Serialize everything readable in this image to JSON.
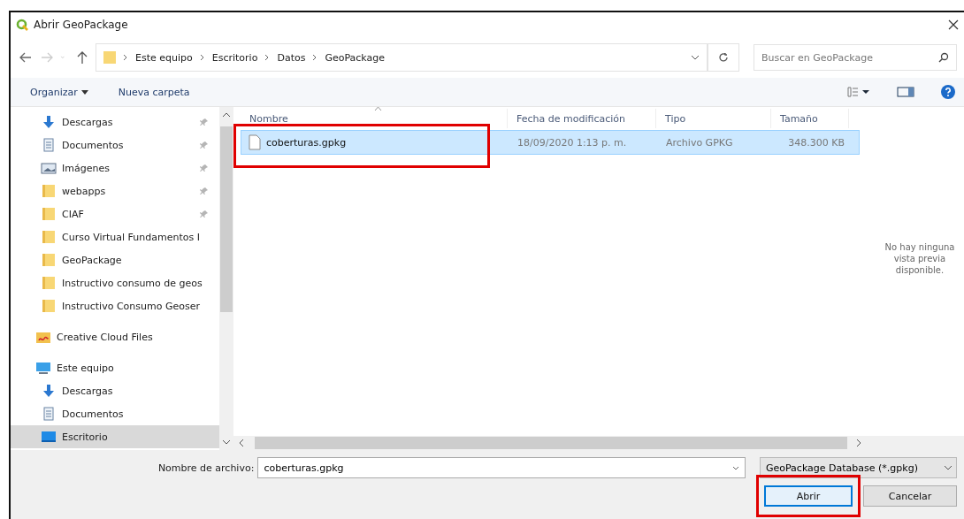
{
  "window": {
    "title": "Abrir GeoPackage"
  },
  "address_bar": {
    "path": [
      "Este equipo",
      "Escritorio",
      "Datos",
      "GeoPackage"
    ]
  },
  "search": {
    "placeholder": "Buscar en GeoPackage"
  },
  "toolbar": {
    "organize": "Organizar",
    "new_folder": "Nueva carpeta"
  },
  "sidebar": {
    "quick_access": [
      {
        "label": "Descargas",
        "kind": "download",
        "pinned": true,
        "selected": false
      },
      {
        "label": "Documentos",
        "kind": "document",
        "pinned": true,
        "selected": false
      },
      {
        "label": "Imágenes",
        "kind": "images",
        "pinned": true,
        "selected": false
      },
      {
        "label": "webapps",
        "kind": "folder",
        "pinned": true,
        "selected": false
      },
      {
        "label": "CIAF",
        "kind": "folder",
        "pinned": true,
        "selected": false
      },
      {
        "label": "Curso Virtual Fundamentos I",
        "kind": "folder",
        "pinned": false,
        "selected": false
      },
      {
        "label": "GeoPackage",
        "kind": "folder",
        "pinned": false,
        "selected": false
      },
      {
        "label": "Instructivo consumo de geos",
        "kind": "folder",
        "pinned": false,
        "selected": false
      },
      {
        "label": "Instructivo Consumo Geoser",
        "kind": "folder",
        "pinned": false,
        "selected": false
      }
    ],
    "items": [
      {
        "label": "Creative Cloud Files",
        "kind": "cloud",
        "selected": false
      },
      {
        "label": "Este equipo",
        "kind": "pc",
        "selected": false,
        "children": [
          {
            "label": "Descargas",
            "kind": "download",
            "selected": false
          },
          {
            "label": "Documentos",
            "kind": "document",
            "selected": false
          },
          {
            "label": "Escritorio",
            "kind": "desktop",
            "selected": true
          }
        ]
      }
    ]
  },
  "table": {
    "columns": [
      {
        "label": "Nombre",
        "sorted": true
      },
      {
        "label": "Fecha de modificación",
        "sorted": false
      },
      {
        "label": "Tipo",
        "sorted": false
      },
      {
        "label": "Tamaño",
        "sorted": false
      }
    ],
    "rows": [
      {
        "name": "coberturas.gpkg",
        "modified": "18/09/2020 1:13 p. m.",
        "type": "Archivo GPKG",
        "size": "348.300 KB",
        "selected": true,
        "annotated": true
      }
    ]
  },
  "preview": {
    "message": "No hay ninguna vista previa disponible."
  },
  "file_name": {
    "label": "Nombre de archivo:",
    "value": "coberturas.gpkg"
  },
  "file_type": {
    "value": "GeoPackage Database (*.gpkg)"
  },
  "buttons": [
    {
      "label": "Abrir",
      "default": true,
      "annotated": true
    },
    {
      "label": "Cancelar",
      "default": false,
      "annotated": false
    }
  ]
}
